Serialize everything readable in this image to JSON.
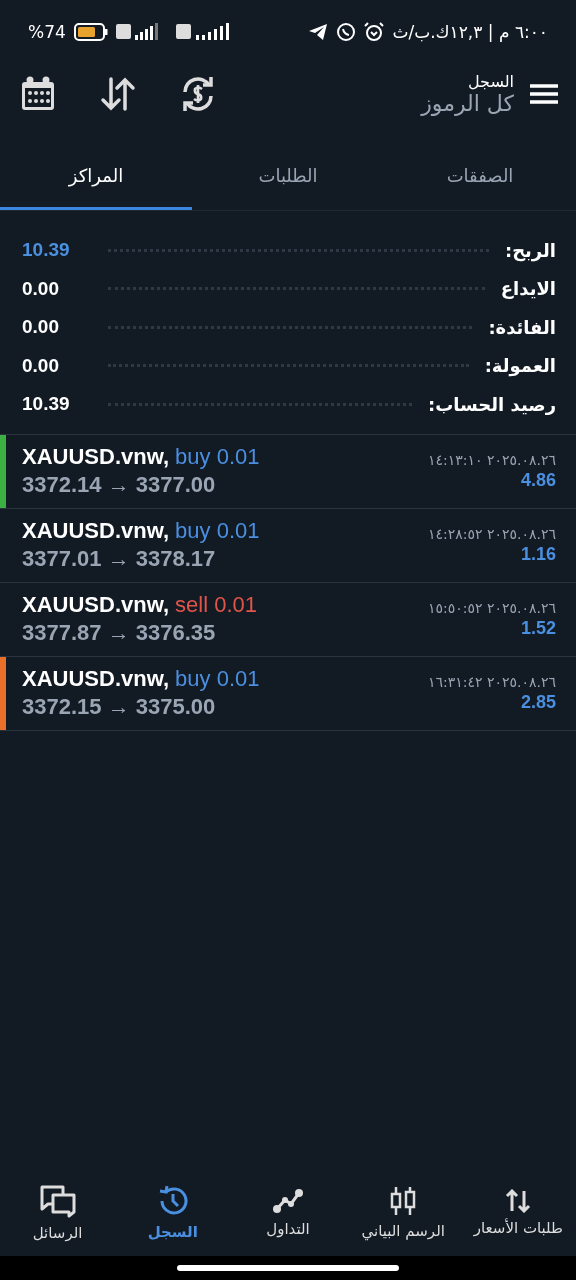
{
  "status_bar": {
    "battery_text": "%74",
    "time_text": "٦:٠٠ م | ١٢,٣ك.ب/ث"
  },
  "header": {
    "title": "السجل",
    "subtitle": "كل الرموز"
  },
  "tabs": [
    {
      "label": "الصفقات",
      "selected": false
    },
    {
      "label": "الطلبات",
      "selected": false
    },
    {
      "label": "المراكز",
      "selected": true
    }
  ],
  "summary": [
    {
      "label": "الربح:",
      "value": "10.39",
      "kind": "highlight"
    },
    {
      "label": "الايداع",
      "value": "0.00",
      "kind": "plain"
    },
    {
      "label": "الفائدة:",
      "value": "0.00",
      "kind": "plain"
    },
    {
      "label": "العمولة:",
      "value": "0.00",
      "kind": "plain"
    },
    {
      "label": "رصيد الحساب:",
      "value": "10.39",
      "kind": "plain"
    }
  ],
  "trades": [
    {
      "symbol": "XAUUSD.vnw,",
      "side": "buy 0.01",
      "kind": "buy",
      "prices": "3372.14 → 3377.00",
      "time": "٢٠٢٥.٠٨.٢٦ ١٤:١٣:١٠",
      "profit": "4.86",
      "color": "#3cb043"
    },
    {
      "symbol": "XAUUSD.vnw,",
      "side": "buy 0.01",
      "kind": "buy",
      "prices": "3377.01 → 3378.17",
      "time": "٢٠٢٥.٠٨.٢٦ ١٤:٢٨:٥٢",
      "profit": "1.16"
    },
    {
      "symbol": "XAUUSD.vnw,",
      "side": "sell 0.01",
      "kind": "sell",
      "prices": "3377.87 → 3376.35",
      "time": "٢٠٢٥.٠٨.٢٦ ١٥:٥٠:٥٢",
      "profit": "1.52"
    },
    {
      "symbol": "XAUUSD.vnw,",
      "side": "buy 0.01",
      "kind": "buy",
      "prices": "3372.15 → 3375.00",
      "time": "٢٠٢٥.٠٨.٢٦ ١٦:٣١:٤٢",
      "profit": "2.85",
      "color": "#e8702a"
    }
  ],
  "bottom_nav": [
    {
      "label": "طلبات الأسعار",
      "kind": "arrows",
      "selected": false
    },
    {
      "label": "الرسم البياني",
      "kind": "candles",
      "selected": false
    },
    {
      "label": "التداول",
      "kind": "trend",
      "selected": false
    },
    {
      "label": "السجل",
      "kind": "history",
      "selected": true
    },
    {
      "label": "الرسائل",
      "kind": "chat",
      "selected": false
    }
  ]
}
